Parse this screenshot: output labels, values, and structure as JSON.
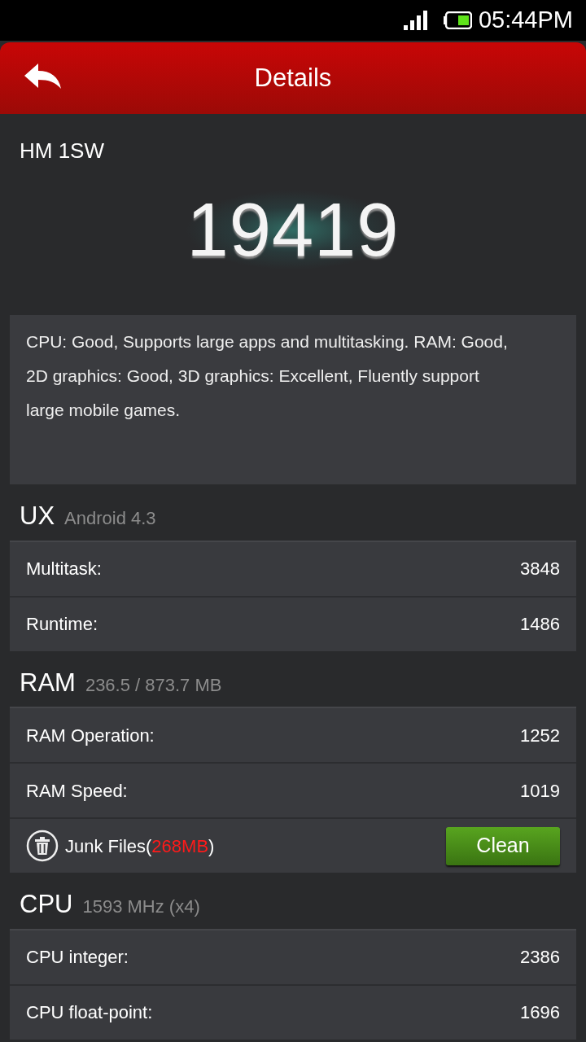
{
  "status_bar": {
    "time": "05:44PM"
  },
  "header": {
    "title": "Details"
  },
  "device": "HM 1SW",
  "score": "19419",
  "description": "CPU: Good, Supports large apps and multitasking. RAM: Good, 2D graphics: Good, 3D graphics: Excellent, Fluently support large mobile games.",
  "sections": [
    {
      "title": "UX",
      "subtitle": "Android 4.3",
      "rows": [
        {
          "kind": "score",
          "label": "Multitask:",
          "value": "3848"
        },
        {
          "kind": "score",
          "label": "Runtime:",
          "value": "1486"
        }
      ]
    },
    {
      "title": "RAM",
      "subtitle": "236.5 / 873.7 MB",
      "rows": [
        {
          "kind": "score",
          "label": "RAM Operation:",
          "value": "1252"
        },
        {
          "kind": "score",
          "label": "RAM Speed:",
          "value": "1019"
        },
        {
          "kind": "junk",
          "text_before": "Junk Files(",
          "size": "268MB",
          "text_after": ")",
          "button": "Clean"
        }
      ]
    },
    {
      "title": "CPU",
      "subtitle": "1593 MHz (x4)",
      "rows": [
        {
          "kind": "score",
          "label": "CPU integer:",
          "value": "2386"
        },
        {
          "kind": "score",
          "label": "CPU float-point:",
          "value": "1696"
        }
      ]
    }
  ]
}
